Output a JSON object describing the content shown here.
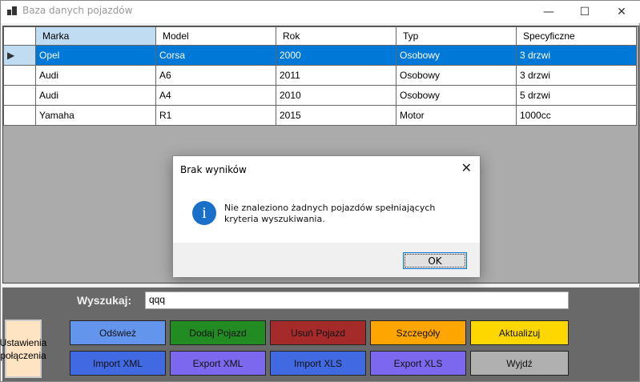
{
  "window": {
    "title": "Baza danych pojazdów",
    "minimize": "—",
    "maximize": "☐",
    "close": "✕"
  },
  "grid": {
    "columns": [
      "Marka",
      "Model",
      "Rok",
      "Typ",
      "Specyficzne"
    ],
    "rows": [
      [
        "Opel",
        "Corsa",
        "2000",
        "Osobowy",
        "3 drzwi"
      ],
      [
        "Audi",
        "A6",
        "2011",
        "Osobowy",
        "3 drzwi"
      ],
      [
        "Audi",
        "A4",
        "2010",
        "Osobowy",
        "5 drzwi"
      ],
      [
        "Yamaha",
        "R1",
        "2015",
        "Motor",
        "1000cc"
      ]
    ]
  },
  "search": {
    "label": "Wyszukaj:",
    "value": "qqq"
  },
  "buttons": {
    "settings": "Ustawienia połączenia",
    "refresh": "Odśwież",
    "add": "Dodaj Pojazd",
    "delete": "Usuń Pojazd",
    "details": "Szczegóły",
    "update": "Aktualizuj",
    "import_xml": "Import XML",
    "export_xml": "Export XML",
    "import_xls": "Import XLS",
    "export_xls": "Export XLS",
    "exit": "Wyjdź"
  },
  "colors": {
    "refresh": "#6495ed",
    "add": "#228b22",
    "delete": "#a52a2a",
    "details": "#ffa500",
    "update": "#ffd700",
    "import_xml": "#4169e1",
    "export_xml": "#7b68ee",
    "import_xls": "#4169e1",
    "export_xls": "#7b68ee",
    "exit": "#b0b0b0"
  },
  "dialog": {
    "title": "Brak wyników",
    "close": "✕",
    "icon": "i",
    "message": "Nie znaleziono żadnych pojazdów spełniających kryteria wyszukiwania.",
    "ok": "OK"
  }
}
